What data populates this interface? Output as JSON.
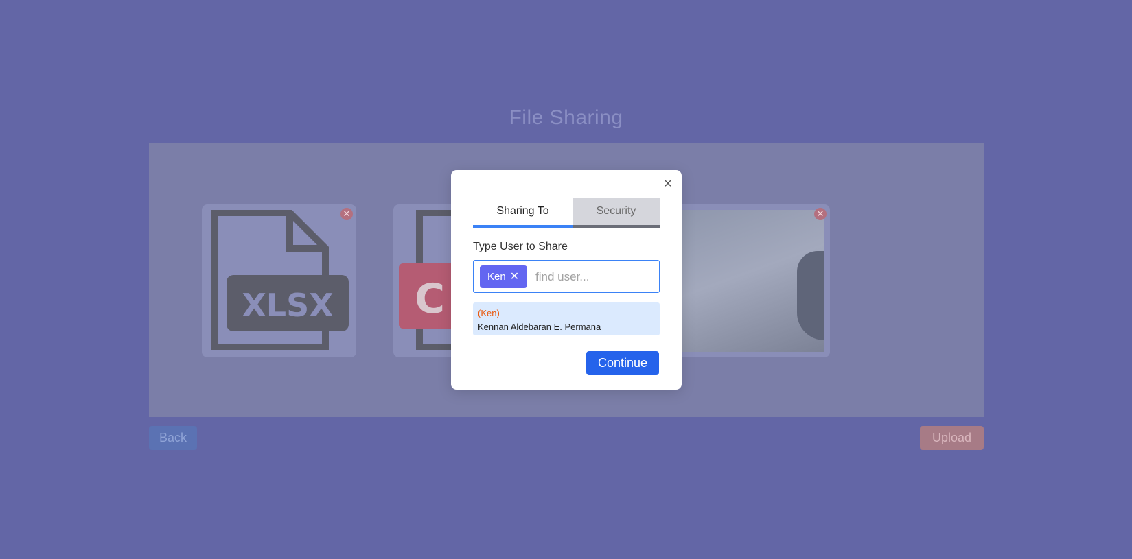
{
  "page": {
    "title": "File Sharing",
    "back_label": "Back",
    "upload_label": "Upload"
  },
  "files": [
    {
      "type": "XLSX",
      "icon": "xlsx-file-icon"
    },
    {
      "type": "C",
      "icon": "csv-file-icon"
    },
    {
      "type": "photo",
      "icon": "image-thumbnail"
    }
  ],
  "modal": {
    "close_symbol": "×",
    "tabs": [
      {
        "label": "Sharing To",
        "active": true
      },
      {
        "label": "Security",
        "active": false
      }
    ],
    "field_label": "Type User to Share",
    "chip_label": "Ken",
    "chip_remove_symbol": "✕",
    "input_value": "",
    "input_placeholder": "find user...",
    "suggestion": {
      "nickname": "(Ken)",
      "fullname": "Kennan Aldebaran E. Permana"
    },
    "continue_label": "Continue"
  },
  "colors": {
    "overlay": "#6366a6",
    "accent": "#3b82f6",
    "chip": "#6366f1",
    "primary_button": "#2563eb",
    "suggestion_bg": "#dbeafe",
    "nickname_text": "#ea580c"
  }
}
